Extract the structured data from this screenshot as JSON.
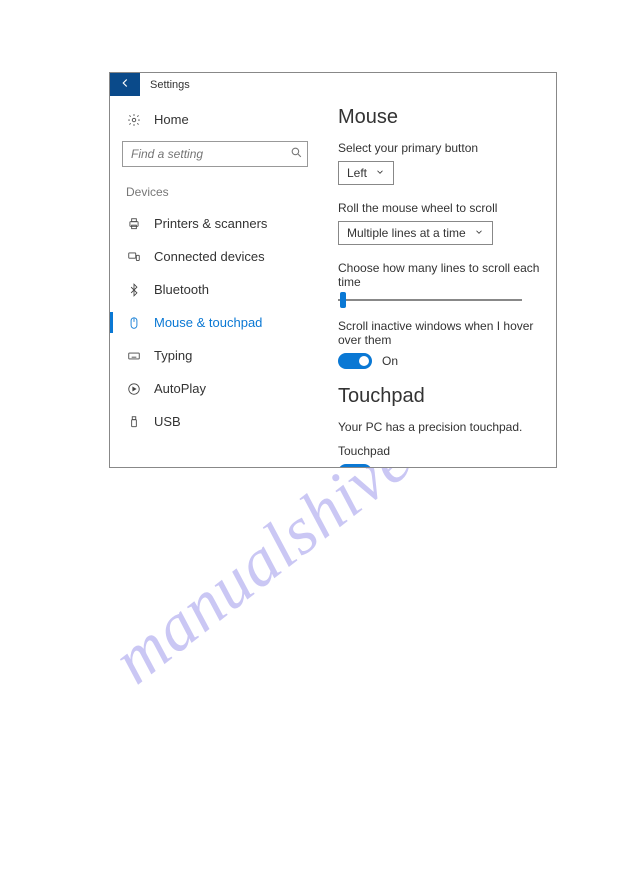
{
  "window": {
    "title": "Settings"
  },
  "sidebar": {
    "home": "Home",
    "search_placeholder": "Find a setting",
    "group": "Devices",
    "items": [
      {
        "label": "Printers & scanners"
      },
      {
        "label": "Connected devices"
      },
      {
        "label": "Bluetooth"
      },
      {
        "label": "Mouse & touchpad"
      },
      {
        "label": "Typing"
      },
      {
        "label": "AutoPlay"
      },
      {
        "label": "USB"
      }
    ]
  },
  "main": {
    "mouse": {
      "heading": "Mouse",
      "primary_label": "Select your primary button",
      "primary_value": "Left",
      "wheel_label": "Roll the mouse wheel to scroll",
      "wheel_value": "Multiple lines at a time",
      "lines_label": "Choose how many lines to scroll each time",
      "hover_label": "Scroll inactive windows when I hover over them",
      "hover_state": "On"
    },
    "touchpad": {
      "heading": "Touchpad",
      "desc": "Your PC has a precision touchpad.",
      "toggle_label": "Touchpad",
      "toggle_state": "On"
    }
  },
  "watermark": "manualshive.com"
}
